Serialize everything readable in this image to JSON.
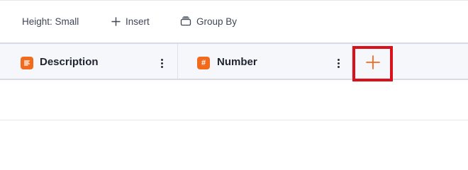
{
  "toolbar": {
    "height_label": "Height: Small",
    "insert_label": "Insert",
    "insert_icon": "plus-icon",
    "group_by_label": "Group By",
    "group_by_icon": "group-by-icon"
  },
  "columns": [
    {
      "title": "Description",
      "type_icon": "text-lines-icon",
      "badge_color": "#f26b1d"
    },
    {
      "title": "Number",
      "type_icon": "hash-icon",
      "type_glyph": "#",
      "badge_color": "#f26b1d"
    }
  ],
  "add_column": {
    "icon": "plus-icon",
    "icon_color": "#f26b1d",
    "highlight_color": "#d9111a"
  }
}
